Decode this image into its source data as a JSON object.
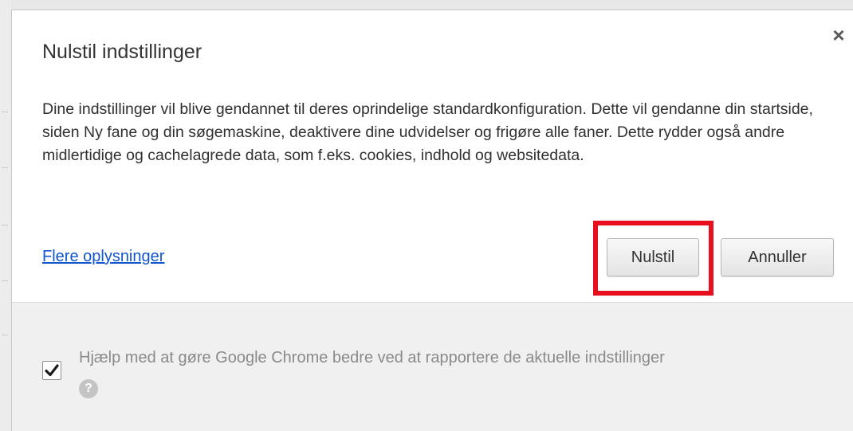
{
  "dialog": {
    "title": "Nulstil indstillinger",
    "close_glyph": "×",
    "close_icon": "close-icon",
    "description": "Dine indstillinger vil blive gendannet til deres oprindelige standardkonfiguration. Dette vil gendanne din startside, siden Ny fane og din søgemaskine, deaktivere dine udvidelser og frigøre alle faner. Dette rydder også andre midlertidige og cachelagrede data, som f.eks. cookies, indhold og websitedata.",
    "learn_more_link": "Flere oplysninger",
    "reset_button": "Nulstil",
    "cancel_button": "Annuller",
    "highlight_color": "#e8101f"
  },
  "footer": {
    "checkbox_checked": true,
    "consent_label": "Hjælp med at gøre Google Chrome bedre ved at rapportere de aktuelle indstillinger",
    "help_icon": "help-icon",
    "help_glyph": "?"
  },
  "colors": {
    "link": "#1155cc",
    "footer_bg": "#f0f0f0",
    "text": "#333333"
  }
}
